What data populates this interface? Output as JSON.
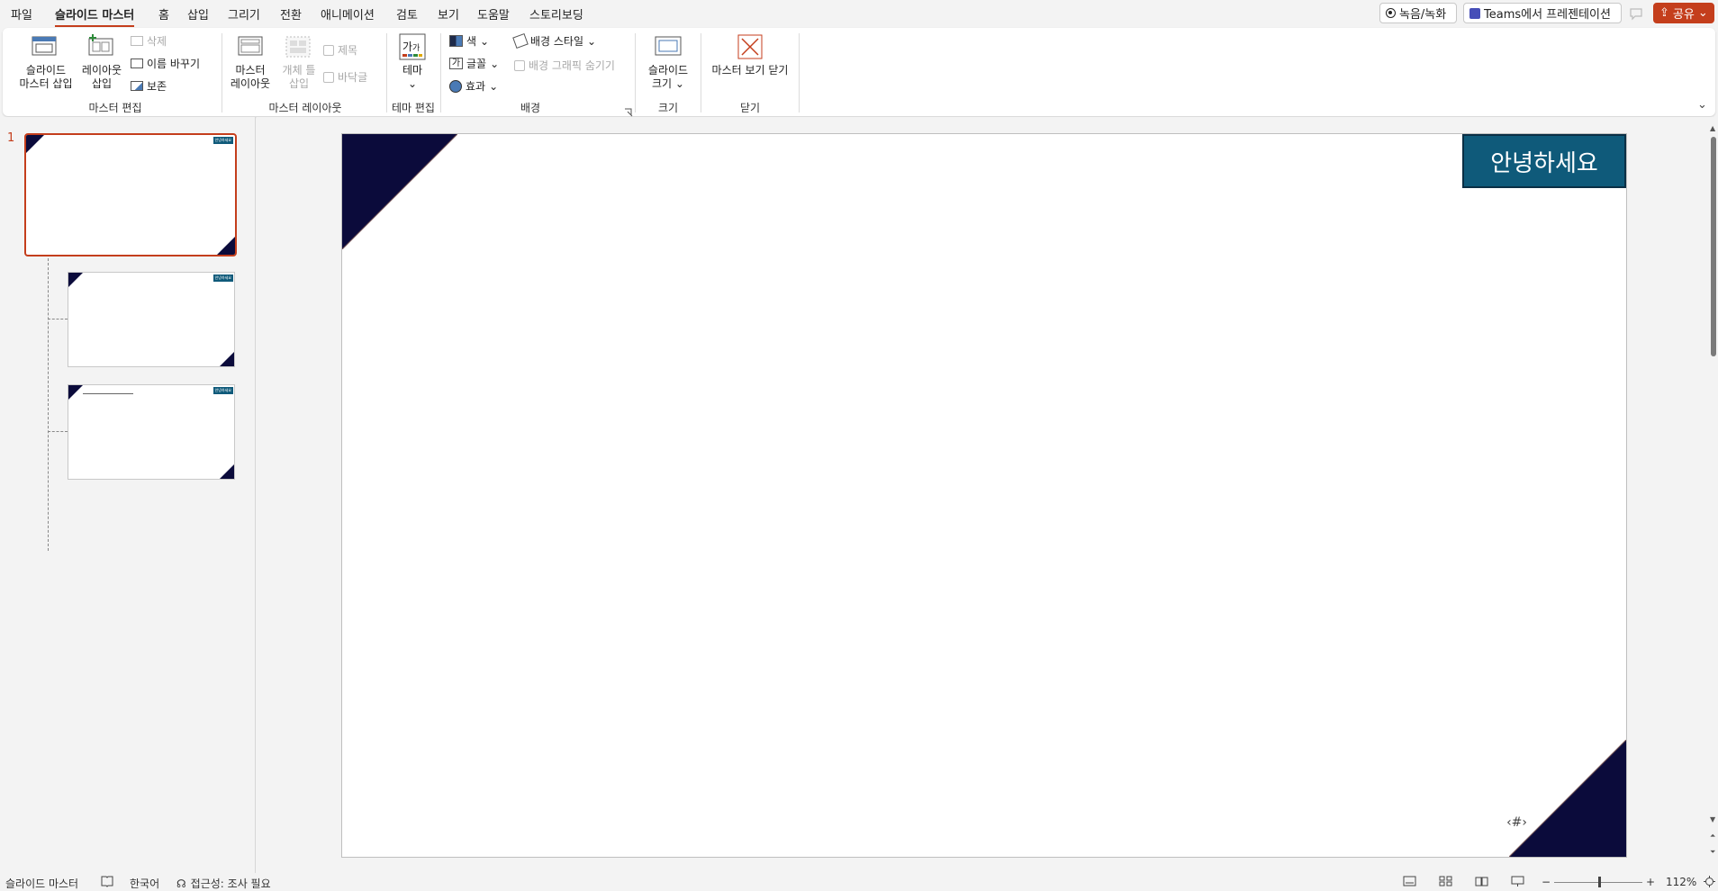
{
  "menu": {
    "items": [
      "파일",
      "슬라이드 마스터",
      "홈",
      "삽입",
      "그리기",
      "전환",
      "애니메이션",
      "검토",
      "보기",
      "도움말",
      "스토리보딩"
    ],
    "record_label": "녹음/녹화",
    "teams_label": "Teams에서 프레젠테이션",
    "share_label": "공유"
  },
  "ribbon": {
    "insert_master": "슬라이드\n마스터 삽입",
    "insert_layout": "레이아웃\n삽입",
    "delete": "삭제",
    "rename": "이름 바꾸기",
    "preserve": "보존",
    "master_layout": "마스터\n레이아웃",
    "insert_placeholder": "개체 틀\n삽입",
    "title_chk": "제목",
    "footer_chk": "바닥글",
    "theme": "테마",
    "colors": "색",
    "fonts": "글꼴",
    "effects": "효과",
    "bg_styles": "배경 스타일",
    "hide_bg": "배경 그래픽 숨기기",
    "slide_size": "슬라이드\n크기",
    "close_master": "마스터 보기 닫기",
    "groups": {
      "edit_master": "마스터 편집",
      "master_layout": "마스터 레이아웃",
      "edit_theme": "테마 편집",
      "background": "배경",
      "size": "크기",
      "close": "닫기"
    }
  },
  "thumbs": {
    "master_number": "1",
    "badge": "안녕하세요"
  },
  "slide": {
    "hello": "안녕하세요",
    "slide_number": "‹#›"
  },
  "status": {
    "view": "슬라이드 마스터",
    "language": "한국어",
    "accessibility": "접근성: 조사 필요",
    "zoom": "112%"
  },
  "colors": {
    "accent": "#c43e1c",
    "navy": "#0b0b3b",
    "teal": "#0f5a7a"
  }
}
